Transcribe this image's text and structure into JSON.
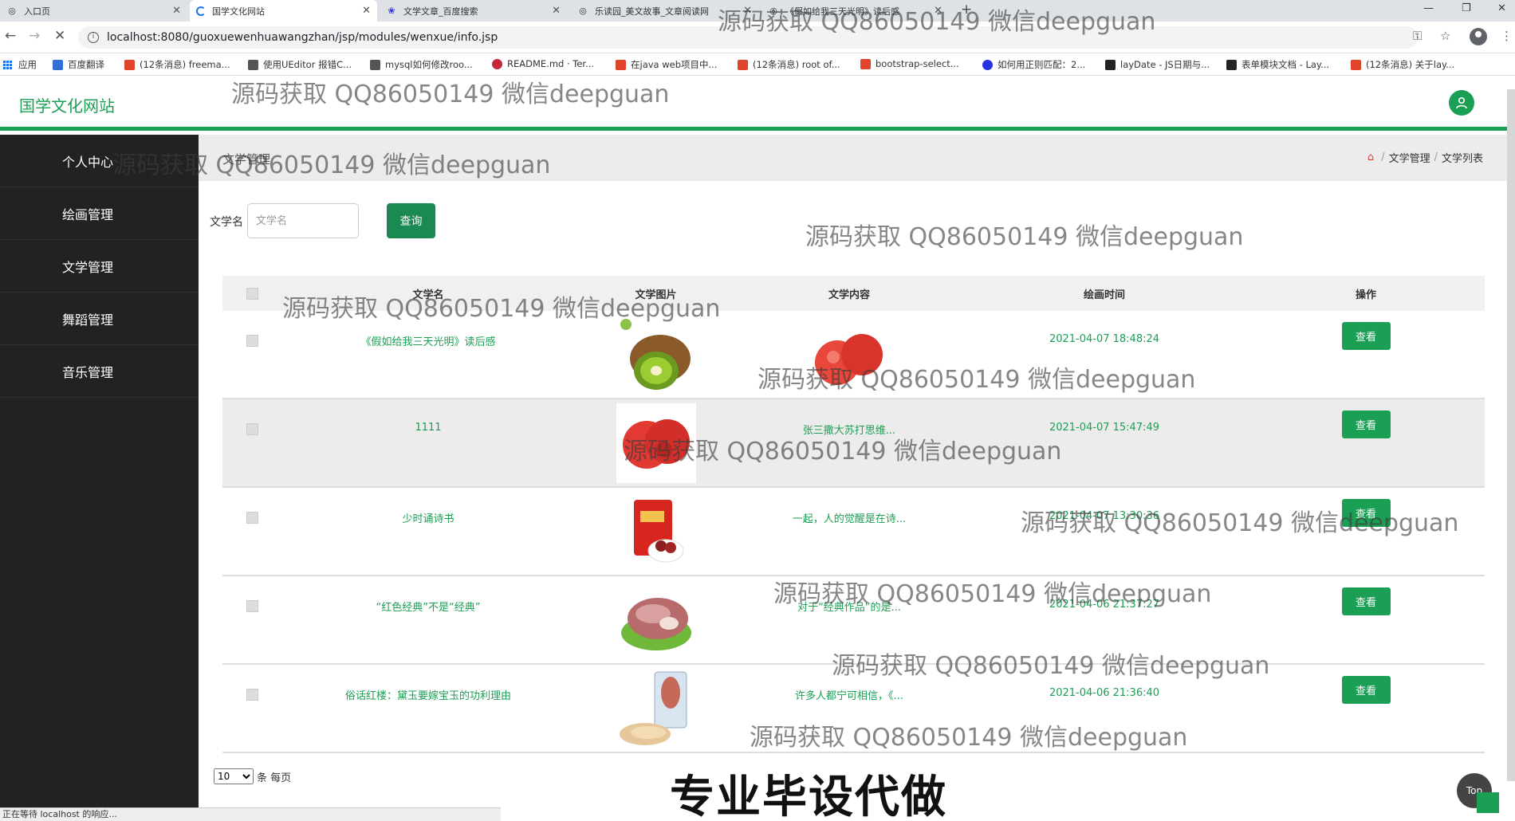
{
  "browser": {
    "tabs": [
      {
        "title": "入口页",
        "close": "✕"
      },
      {
        "title": "国学文化网站",
        "close": "✕"
      },
      {
        "title": "文学文章_百度搜索",
        "close": "✕"
      },
      {
        "title": "乐读园_美文故事_文章阅读网",
        "close": "✕"
      },
      {
        "title": "《假如给我三天光明》读后感",
        "close": "✕"
      }
    ],
    "new_tab": "+",
    "url": "localhost:8080/guoxuewenhuawangzhan/jsp/modules/wenxue/info.jsp",
    "bookmarks": [
      {
        "label": "应用",
        "color": "#1a73e8"
      },
      {
        "label": "百度翻译",
        "color": "#2f6fd6"
      },
      {
        "label": "(12条消息) freema...",
        "color": "#e0452b"
      },
      {
        "label": "使用UEditor 报错C...",
        "color": "#333333"
      },
      {
        "label": "mysql如何修改roo...",
        "color": "#333333"
      },
      {
        "label": "README.md · Ter...",
        "color": "#c7253e"
      },
      {
        "label": "在java web项目中...",
        "color": "#e0452b"
      },
      {
        "label": "(12条消息) root of...",
        "color": "#e0452b"
      },
      {
        "label": "bootstrap-select...",
        "color": "#e0452b"
      },
      {
        "label": "如何用正则匹配：2...",
        "color": "#2932e1"
      },
      {
        "label": "layDate - JS日期与...",
        "color": "#222222"
      },
      {
        "label": "表单模块文档 - Lay...",
        "color": "#222222"
      },
      {
        "label": "(12条消息) 关于lay...",
        "color": "#e0452b"
      }
    ],
    "status": "正在等待 localhost 的响应..."
  },
  "app": {
    "brand": "国学文化网站",
    "sidebar": [
      "个人中心",
      "绘画管理",
      "文学管理",
      "舞蹈管理",
      "音乐管理"
    ],
    "page_title": "文学管理",
    "breadcrumb": {
      "home_icon": "home-icon",
      "parent": "文学管理",
      "current": "文学列表",
      "separator": "/"
    },
    "search": {
      "label": "文学名",
      "placeholder": "文学名",
      "button": "查询"
    },
    "table": {
      "headers": {
        "name": "文学名",
        "image": "文学图片",
        "content": "文学内容",
        "time": "绘画时间",
        "op": "操作"
      },
      "rows": [
        {
          "name": "《假如给我三天光明》读后感",
          "image": "kiwi-fruit",
          "content": "",
          "content_image": "apples",
          "time": "2021-04-07 18:48:24",
          "op": "查看"
        },
        {
          "name": "1111",
          "image": "apples",
          "content": "张三撒大苏打思维...",
          "time": "2021-04-07 15:47:49",
          "op": "查看"
        },
        {
          "name": "少时诵诗书",
          "image": "red-dates-pack",
          "content": "一起，人的觉醒是在诗...",
          "time": "2021-04-07 13:30:36",
          "op": "查看"
        },
        {
          "name": "“红色经典”不是“经典”",
          "image": "meat-on-lettuce",
          "content": "对于“经典作品”的是...",
          "time": "2021-04-06 21:37:27",
          "op": "查看"
        },
        {
          "name": "俗话红楼：黛玉要嫁宝玉的功利理由",
          "image": "fish-package",
          "content": "许多人都宁可相信，《...",
          "time": "2021-04-06 21:36:40",
          "op": "查看"
        }
      ]
    },
    "pager": {
      "page_size": "10",
      "suffix": "条 每页"
    },
    "top_button": "Top"
  },
  "overlay": {
    "watermark": "源码获取 QQ86050149 微信deepguan",
    "banner": "专业毕设代做"
  }
}
